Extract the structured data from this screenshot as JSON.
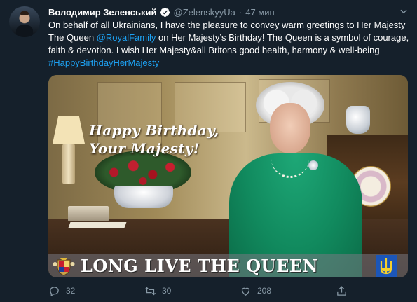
{
  "tweet": {
    "author_name": "Володимир Зеленський",
    "handle": "@ZelenskyyUa",
    "separator": "·",
    "time": "47 мин",
    "text_segments": [
      {
        "type": "text",
        "value": "On behalf of all Ukrainians, I have the pleasure to convey warm greetings to Her Majesty The Queen "
      },
      {
        "type": "mention",
        "value": "@RoyalFamily"
      },
      {
        "type": "text",
        "value": " on Her Majesty’s Birthday! The Queen is a symbol of courage, faith & devotion. I wish Her Majesty&all Britons good health, harmony & well-being "
      },
      {
        "type": "hashtag",
        "value": "#HappyBirthdayHerMajesty"
      }
    ],
    "media": {
      "greeting_line1": "Happy Birthday,",
      "greeting_line2": "Your Majesty!",
      "banner_text": "LONG LIVE THE QUEEN"
    },
    "actions": {
      "replies": "32",
      "retweets": "30",
      "likes": "208"
    }
  },
  "colors": {
    "background": "#15202b",
    "text": "#ffffff",
    "secondary": "#8899a6",
    "link": "#1da1f2",
    "verified": "#1da1f2"
  },
  "icons": [
    "verified-badge-icon",
    "chevron-down-icon",
    "reply-icon",
    "retweet-icon",
    "like-icon",
    "share-icon",
    "coat-of-arms-icon",
    "ukraine-trident-icon"
  ]
}
